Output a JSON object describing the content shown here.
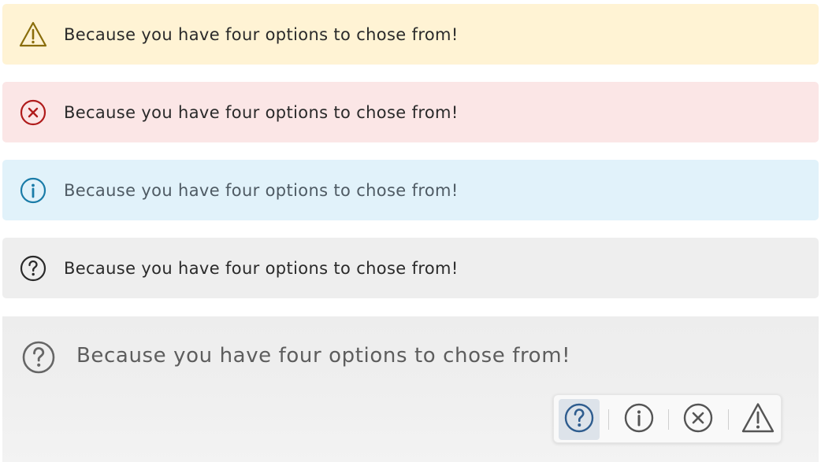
{
  "alerts": [
    {
      "type": "warning",
      "icon": "warning-icon",
      "message": "Because you have four options to chose from!",
      "background": "#fff3d4",
      "icon_color": "#8a6d0b"
    },
    {
      "type": "error",
      "icon": "error-icon",
      "message": "Because you have four options to chose from!",
      "background": "#fbe6e6",
      "icon_color": "#b01c1c"
    },
    {
      "type": "info",
      "icon": "info-icon",
      "message": "Because you have four options to chose from!",
      "background": "#e1f2fa",
      "icon_color": "#1a7ca8"
    },
    {
      "type": "help",
      "icon": "question-icon",
      "message": "Because you have four options to chose from!",
      "background": "#eeeeee",
      "icon_color": "#2a2a2a"
    }
  ],
  "preview": {
    "icon": "question-icon",
    "message": "Because you have four options to chose from!",
    "icon_picker": {
      "options": [
        "question-icon",
        "info-icon",
        "error-icon",
        "warning-icon"
      ],
      "selected": "question-icon"
    }
  }
}
